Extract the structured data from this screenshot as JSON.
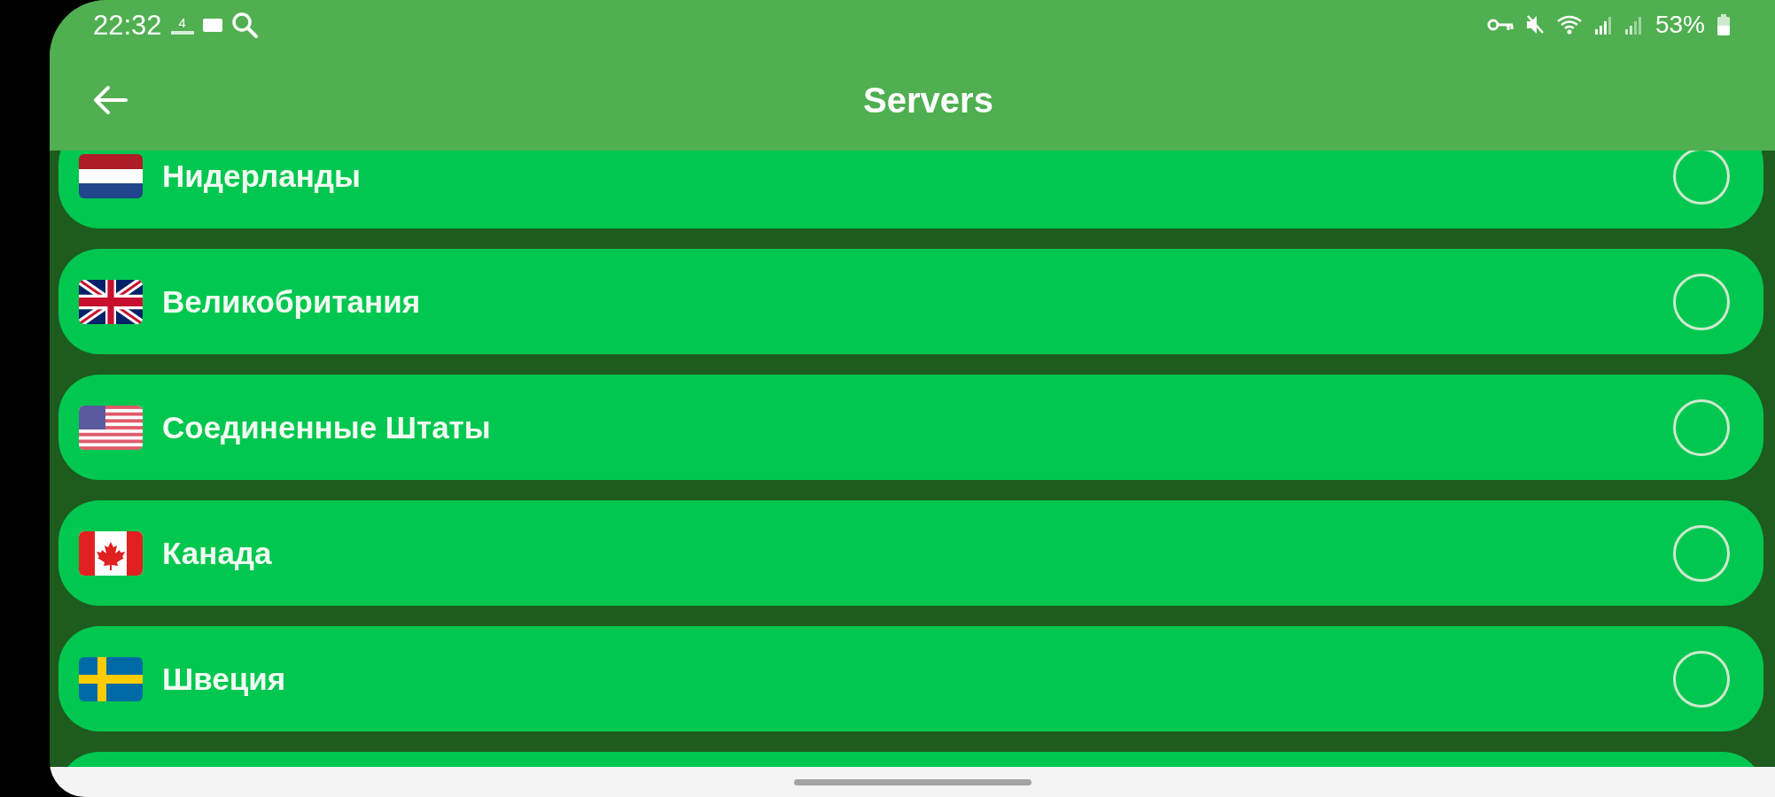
{
  "status_bar": {
    "time": "22:32",
    "network_speed": "4",
    "battery": "53%"
  },
  "toolbar": {
    "title": "Servers"
  },
  "servers": [
    {
      "name": "Нидерланды",
      "kind": "netherlands",
      "selected": false
    },
    {
      "name": "Великобритания",
      "kind": "britain",
      "selected": false
    },
    {
      "name": "Соединенные Штаты",
      "kind": "usa",
      "selected": false
    },
    {
      "name": "Канада",
      "kind": "canada",
      "selected": false
    },
    {
      "name": "Швеция",
      "kind": "sweden",
      "selected": false
    }
  ]
}
